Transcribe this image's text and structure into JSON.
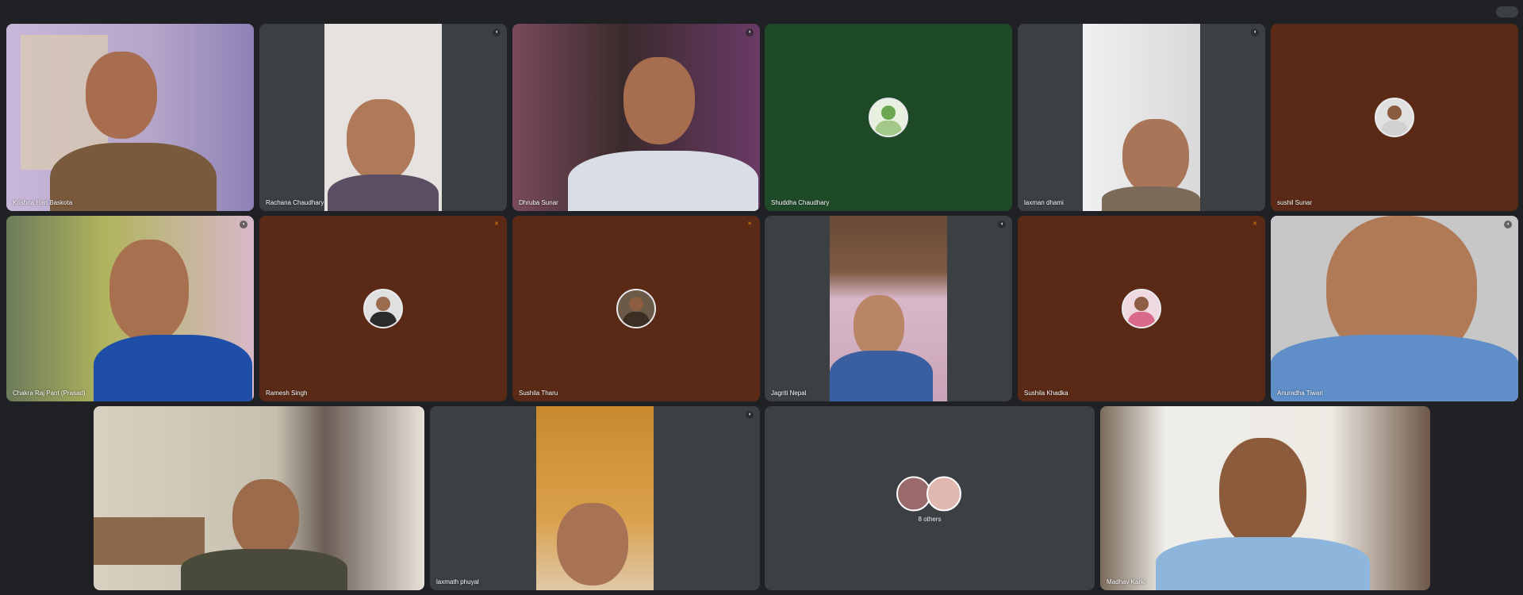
{
  "call": {
    "participants": [
      {
        "name": "Krishna Hari Baskota",
        "mic": "on"
      },
      {
        "name": "Rachana Chaudhary",
        "mic": "on"
      },
      {
        "name": "Dhruba Sunar",
        "mic": "on"
      },
      {
        "name": "Shuddha Chaudhary",
        "mic": "none"
      },
      {
        "name": "laxman dhami",
        "mic": "on"
      },
      {
        "name": "sushil Sunar",
        "mic": "none"
      },
      {
        "name": "Chakra Raj Pant (Prasad)",
        "mic": "on"
      },
      {
        "name": "Ramesh Singh",
        "mic": "muted"
      },
      {
        "name": "Sushila Tharu",
        "mic": "muted"
      },
      {
        "name": "Jagriti Nepal",
        "mic": "on"
      },
      {
        "name": "Sushila Khadka",
        "mic": "muted"
      },
      {
        "name": "Anuradha Tiwari",
        "mic": "on"
      },
      {
        "name": "",
        "mic": "none"
      },
      {
        "name": "laxmath phuyal",
        "mic": "on"
      },
      {
        "name": "Madhav Karki",
        "mic": "none"
      }
    ],
    "others_label": "8 others"
  },
  "icons": {
    "mic_on": "mic-icon",
    "mic_muted": "mic-off-icon",
    "top_right": "toggle-icon"
  },
  "colors": {
    "background": "#202124",
    "tile_gray": "#3c4043",
    "tile_brown": "#5b2a16",
    "tile_green": "#1f4a28",
    "muted": "#ea8600"
  }
}
